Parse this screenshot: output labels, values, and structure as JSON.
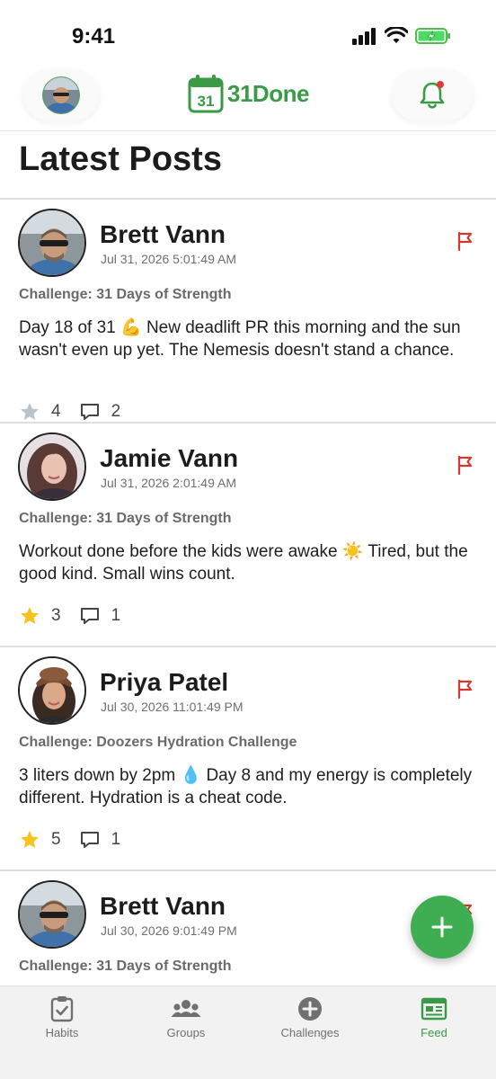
{
  "status_bar": {
    "time": "9:41"
  },
  "header": {
    "app_name": "31Done",
    "logo_day": "31"
  },
  "page": {
    "title": "Latest Posts"
  },
  "posts": [
    {
      "author": "Brett Vann",
      "timestamp": "Jul 31, 2026 5:01:49 AM",
      "challenge": "Challenge: 31 Days of Strength",
      "body": "Day 18 of 31 💪 New deadlift PR this morning and the sun wasn't even up yet. The Nemesis doesn't stand a chance.",
      "stars": "4",
      "starred": false,
      "comments": "2"
    },
    {
      "author": "Jamie Vann",
      "timestamp": "Jul 31, 2026 2:01:49 AM",
      "challenge": "Challenge: 31 Days of Strength",
      "body": "Workout done before the kids were awake ☀️ Tired, but the good kind. Small wins count.",
      "stars": "3",
      "starred": true,
      "comments": "1"
    },
    {
      "author": "Priya Patel",
      "timestamp": "Jul 30, 2026 11:01:49 PM",
      "challenge": "Challenge: Doozers Hydration Challenge",
      "body": "3 liters down by 2pm 💧 Day 8 and my energy is completely different. Hydration is a cheat code.",
      "stars": "5",
      "starred": true,
      "comments": "1"
    },
    {
      "author": "Brett Vann",
      "timestamp": "Jul 30, 2026 9:01:49 PM",
      "challenge": "Challenge: 31 Days of Strength",
      "body": "",
      "stars": "",
      "starred": false,
      "comments": ""
    }
  ],
  "tabs": [
    {
      "label": "Habits",
      "icon": "clipboard-check-icon",
      "active": false
    },
    {
      "label": "Groups",
      "icon": "users-icon",
      "active": false
    },
    {
      "label": "Challenges",
      "icon": "plus-circle-icon",
      "active": false
    },
    {
      "label": "Feed",
      "icon": "newspaper-icon",
      "active": true
    }
  ],
  "colors": {
    "brand_green": "#3a9a45",
    "fab_green": "#3fae52",
    "flag_red": "#d23a30",
    "star_gold": "#f7c21b",
    "star_gray": "#b9c3cc",
    "notification_dot": "#e53935"
  }
}
